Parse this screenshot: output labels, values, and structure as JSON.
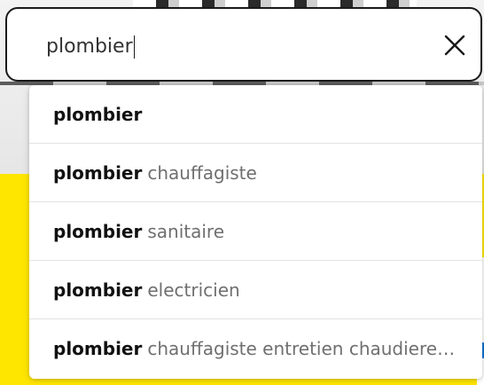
{
  "search": {
    "query": "plombier"
  },
  "suggestions": [
    {
      "match": "plombier",
      "rest": ""
    },
    {
      "match": "plombier",
      "rest": "chauffagiste"
    },
    {
      "match": "plombier",
      "rest": "sanitaire"
    },
    {
      "match": "plombier",
      "rest": "electricien"
    },
    {
      "match": "plombier",
      "rest": "chauffagiste entretien chaudieres…"
    }
  ],
  "colors": {
    "accent_yellow": "#ffe600",
    "input_border": "#1a1a1a",
    "match_text": "#111111",
    "completion_text": "#6f6f6f"
  },
  "icons": {
    "clear": "close-icon"
  }
}
